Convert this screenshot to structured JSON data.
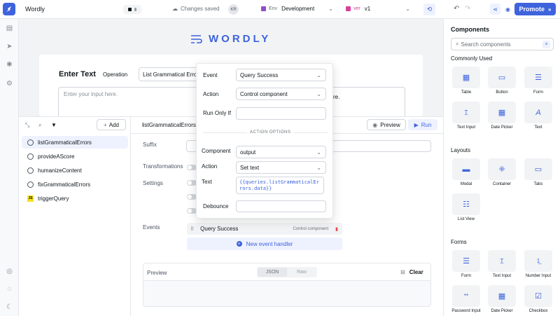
{
  "app": {
    "name": "Wordly",
    "save_status": "Changes saved",
    "user_initials": "KR",
    "env_label": "Env",
    "env_value": "Development",
    "version_label": "ver",
    "version_value": "v1",
    "promote_label": "Promote"
  },
  "canvas": {
    "logo_text": "WORDLY",
    "enter_text_label": "Enter Text",
    "operation_label": "Operation",
    "operation_value": "List Grammatical Errors",
    "input_placeholder": "Enter your input here.",
    "hint_fragment": "re."
  },
  "queries": {
    "add_label": "Add",
    "items": [
      {
        "name": "listGrammaticalErrors",
        "type": "rest"
      },
      {
        "name": "provideAScore",
        "type": "rest"
      },
      {
        "name": "humanizeContent",
        "type": "rest"
      },
      {
        "name": "fixGrammaticalErrors",
        "type": "rest"
      },
      {
        "name": "triggerQuery",
        "type": "js",
        "badge": "JS"
      }
    ],
    "selected_name": "listGrammaticalErrors",
    "preview_label": "Preview",
    "run_label": "Run"
  },
  "editor": {
    "suffix_label": "Suffix",
    "transformations_label": "Transformations",
    "settings_label": "Settings",
    "events_label": "Events",
    "event_row_name": "Query Success",
    "event_row_action": "Control component",
    "new_event_label": "New event handler",
    "preview_title": "Preview",
    "json_tab": "JSON",
    "raw_tab": "Raw",
    "clear_label": "Clear"
  },
  "popover": {
    "event_label": "Event",
    "event_value": "Query Success",
    "action_label": "Action",
    "action_value": "Control component",
    "run_only_if_label": "Run Only If",
    "action_options_title": "ACTION OPTIONS",
    "component_label": "Component",
    "component_value": "output",
    "sub_action_label": "Action",
    "sub_action_value": "Set text",
    "text_label": "Text",
    "text_value": "{{queries.listGrammaticalErrors.data}}",
    "debounce_label": "Debounce"
  },
  "components": {
    "title": "Components",
    "search_placeholder": "Search components",
    "commonly_used_title": "Commonly Used",
    "commonly_used": [
      "Table",
      "Button",
      "Form",
      "Text Input",
      "Date Picker",
      "Text"
    ],
    "layouts_title": "Layouts",
    "layouts": [
      "Modal",
      "Container",
      "Tabs",
      "List View"
    ],
    "forms_title": "Forms",
    "forms": [
      "Form",
      "Text Input",
      "Number Input",
      "Password Input",
      "Date Picker",
      "Checkbox"
    ]
  },
  "colors": {
    "accent": "#3e63dd",
    "selected_bg": "#eef2ff",
    "canvas_bg": "#f1f3f5"
  }
}
